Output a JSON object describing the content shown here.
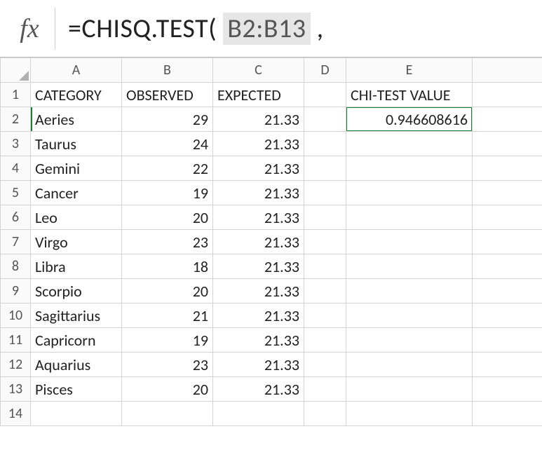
{
  "formula_bar": {
    "fx_label": "fx",
    "prefix": "=CHISQ.TEST( ",
    "range": "B2:B13",
    "suffix": " ,"
  },
  "columns": [
    "A",
    "B",
    "C",
    "D",
    "E"
  ],
  "row_numbers": [
    "1",
    "2",
    "3",
    "4",
    "5",
    "6",
    "7",
    "8",
    "9",
    "10",
    "11",
    "12",
    "13",
    "14"
  ],
  "headers": {
    "A": "CATEGORY",
    "B": "OBSERVED",
    "C": "EXPECTED",
    "E": "CHI-TEST VALUE"
  },
  "data_rows": [
    {
      "category": "Aeries",
      "observed": "29",
      "expected": "21.33"
    },
    {
      "category": "Taurus",
      "observed": "24",
      "expected": "21.33"
    },
    {
      "category": "Gemini",
      "observed": "22",
      "expected": "21.33"
    },
    {
      "category": "Cancer",
      "observed": "19",
      "expected": "21.33"
    },
    {
      "category": "Leo",
      "observed": "20",
      "expected": "21.33"
    },
    {
      "category": "Virgo",
      "observed": "23",
      "expected": "21.33"
    },
    {
      "category": "Libra",
      "observed": "18",
      "expected": "21.33"
    },
    {
      "category": "Scorpio",
      "observed": "20",
      "expected": "21.33"
    },
    {
      "category": "Sagittarius",
      "observed": "21",
      "expected": "21.33"
    },
    {
      "category": "Capricorn",
      "observed": "19",
      "expected": "21.33"
    },
    {
      "category": "Aquarius",
      "observed": "23",
      "expected": "21.33"
    },
    {
      "category": "Pisces",
      "observed": "20",
      "expected": "21.33"
    }
  ],
  "chi_test_value": "0.946608616"
}
